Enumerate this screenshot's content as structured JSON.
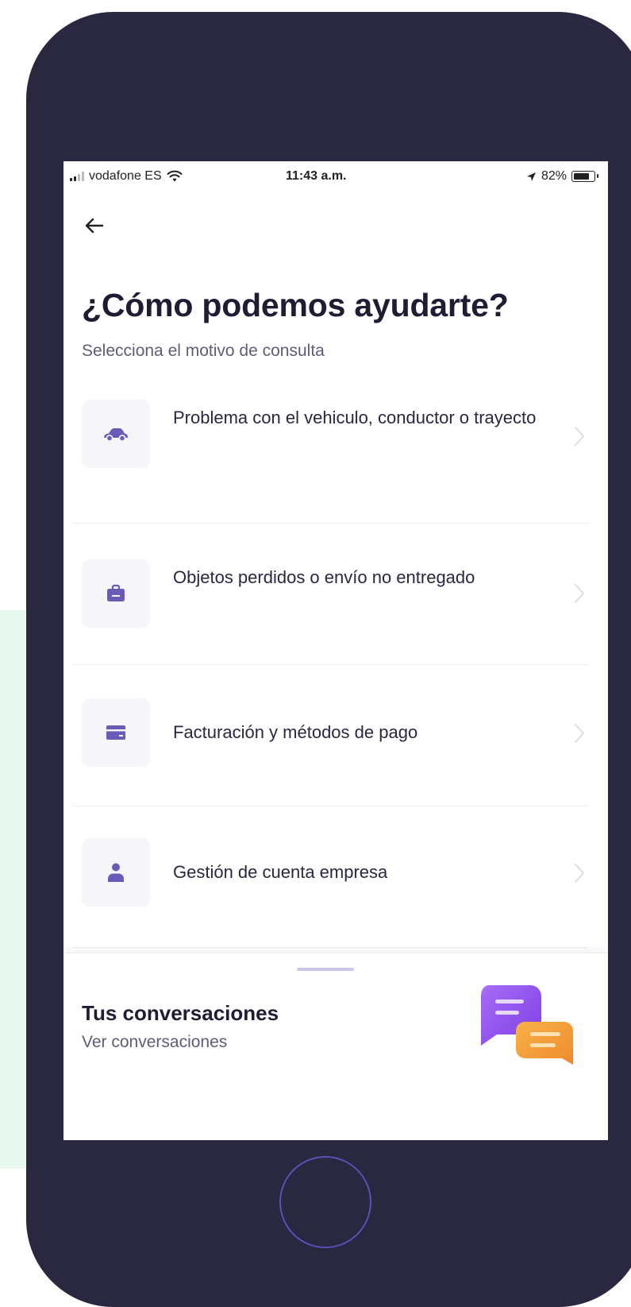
{
  "status_bar": {
    "carrier": "vodafone ES",
    "time": "11:43 a.m.",
    "battery": "82%",
    "battery_level": 0.82
  },
  "header": {
    "back_icon": "arrow-left-icon",
    "title": "¿Cómo podemos ayudarte?",
    "subtitle": "Selecciona el motivo de consulta"
  },
  "options": [
    {
      "icon": "car-icon",
      "label": "Problema con el vehiculo, conductor o trayecto"
    },
    {
      "icon": "briefcase-icon",
      "label": "Objetos perdidos o envío no entregado"
    },
    {
      "icon": "credit-card-icon",
      "label": "Facturación y métodos de pago"
    },
    {
      "icon": "user-icon",
      "label": "Gestión de cuenta empresa"
    }
  ],
  "conversations": {
    "title": "Tus conversaciones",
    "link": "Ver conversaciones",
    "icon": "chat-bubbles-icon"
  },
  "colors": {
    "device_frame": "#2a2740",
    "accent": "#5b4fb8",
    "icon_purple": "#6b5bb8",
    "bubble_purple": "#9b59f0",
    "bubble_orange": "#f5a13a",
    "mint": "#e9f8ef"
  }
}
